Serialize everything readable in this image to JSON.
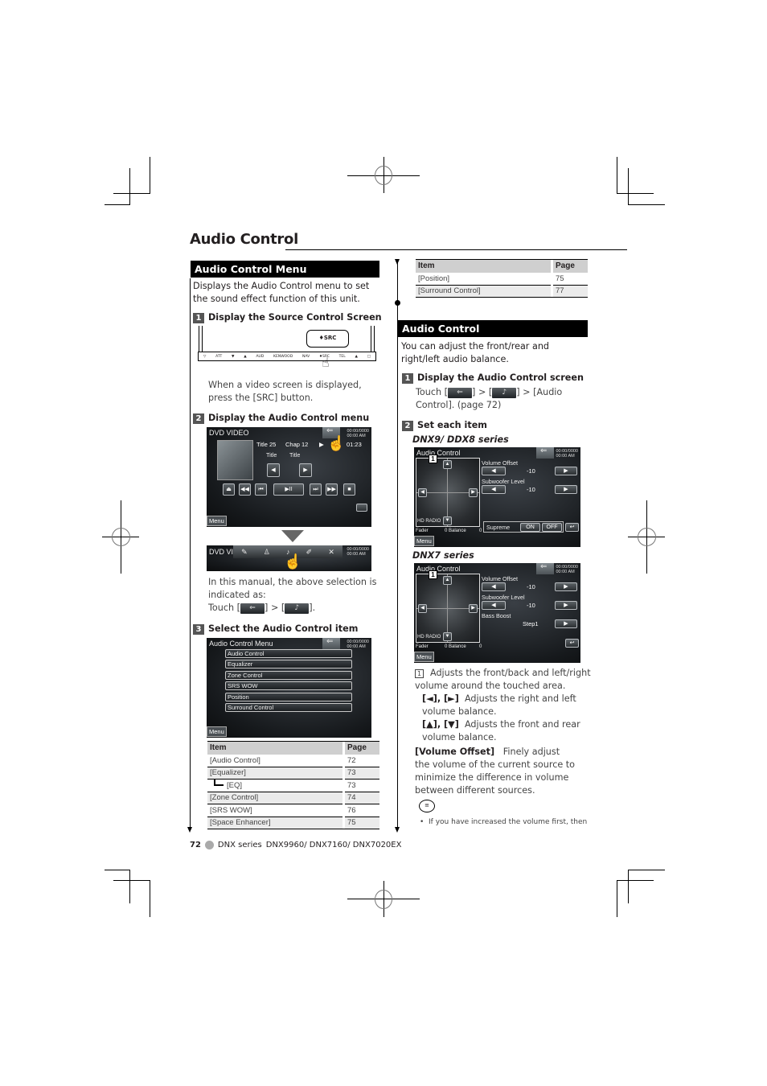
{
  "page": {
    "title": "Audio Control",
    "footer": {
      "page_number": "72",
      "series": "DNX series",
      "models": "DNX9960/ DNX7160/ DNX7020EX"
    }
  },
  "left_column": {
    "section_title": "Audio Control Menu",
    "intro": "Displays the Audio Control menu to set the sound effect function of this unit.",
    "steps": [
      {
        "number": "1",
        "title": "Display the Source Control Screen",
        "bar_labels": [
          "▽",
          "ATT",
          "▼",
          "▲",
          "AUD",
          "KENWOOD",
          "NAV",
          "♦SRC",
          "TEL",
          "▲",
          "□"
        ],
        "callout_label": "♦SRC",
        "note": "When a video screen is displayed, press the [SRC] button."
      },
      {
        "number": "2",
        "title": "Display the Audio Control menu",
        "dvd_screen": {
          "title": "DVD VIDEO",
          "clock": [
            "00:00/0000",
            "00:00 AM"
          ],
          "title_label": "Title 25",
          "chap_label": "Chap 12",
          "play_icon": "▶",
          "time": "01:23",
          "field1": "Title",
          "field2": "Title",
          "menu": "Menu"
        },
        "bar_screen": {
          "title": "DVD VI",
          "clock": [
            "00:00/0000",
            "00:00 AM"
          ]
        },
        "note_line1": "In this manual, the above selection is indicated as:",
        "note_touch": "Touch [",
        "note_mid": "] > [",
        "note_end": "]."
      },
      {
        "number": "3",
        "title": "Select the Audio Control item",
        "menu_screen": {
          "title": "Audio Control Menu",
          "clock": [
            "00:00/0000",
            "00:00 AM"
          ],
          "items": [
            "Audio Control",
            "Equalizer",
            "Zone Control",
            "SRS WOW",
            "Position",
            "Surround Control"
          ],
          "menu": "Menu"
        }
      }
    ],
    "table": {
      "headers": [
        "Item",
        "Page"
      ],
      "rows": [
        {
          "item": "[Audio Control]",
          "page": "72"
        },
        {
          "item": "[Equalizer]",
          "page": "73"
        },
        {
          "item": "[EQ]",
          "page": "73",
          "indent": true
        },
        {
          "item": "[Zone Control]",
          "page": "74"
        },
        {
          "item": "[SRS WOW]",
          "page": "76"
        },
        {
          "item": "[Space Enhancer]",
          "page": "75"
        }
      ]
    }
  },
  "right_column": {
    "continued_table": {
      "headers": [
        "Item",
        "Page"
      ],
      "rows": [
        {
          "item": "[Position]",
          "page": "75"
        },
        {
          "item": "[Surround Control]",
          "page": "77"
        }
      ]
    },
    "section_title": "Audio Control",
    "intro": "You can adjust the front/rear and right/left audio balance.",
    "steps": [
      {
        "number": "1",
        "title": "Display the Audio Control screen",
        "touch_prefix": "Touch [",
        "touch_mid": "] > [",
        "touch_suffix": "] > [Audio Control]. (page 72)"
      },
      {
        "number": "2",
        "title": "Set each item"
      }
    ],
    "series_a": {
      "label": "DNX9/ DDX8 series",
      "screen": {
        "title": "Audio Control",
        "clock": [
          "00:00/0000",
          "00:00 AM"
        ],
        "callout": "1",
        "volume_offset_label": "Volume Offset",
        "volume_offset_value": "-10",
        "subwoofer_label": "Subwoofer Level",
        "subwoofer_value": "-10",
        "hd_radio": "HD RADIO",
        "fader": "Fader",
        "balance": "0  Balance",
        "balance_val": "0",
        "supreme_label": "Supreme",
        "on": "ON",
        "off": "OFF",
        "menu": "Menu"
      }
    },
    "series_b": {
      "label": "DNX7 series",
      "screen": {
        "title": "Audio Control",
        "clock": [
          "00:00/0000",
          "00:00 AM"
        ],
        "callout": "1",
        "volume_offset_label": "Volume Offset",
        "volume_offset_value": "-10",
        "subwoofer_label": "Subwoofer Level",
        "subwoofer_value": "-10",
        "bass_boost_label": "Bass Boost",
        "bass_boost_value": "Step1",
        "hd_radio": "HD RADIO",
        "fader": "Fader",
        "balance": "0  Balance",
        "balance_val": "0",
        "menu": "Menu"
      }
    },
    "descriptions": {
      "callout_num": "1",
      "item1": "Adjusts the front/back and left/right volume around the touched area.",
      "lr_keys": "[◄], [►]",
      "lr_text": "Adjusts the right and left volume balance.",
      "ud_keys": "[▲], [▼]",
      "ud_text": "Adjusts the front and rear volume balance.",
      "vo_key": "[Volume Offset]",
      "vo_text": "Finely adjust the volume of the current source to minimize the difference in volume between different sources.",
      "note_icon": "note-icon",
      "note_bullet": "If you have increased the volume first, then"
    }
  }
}
